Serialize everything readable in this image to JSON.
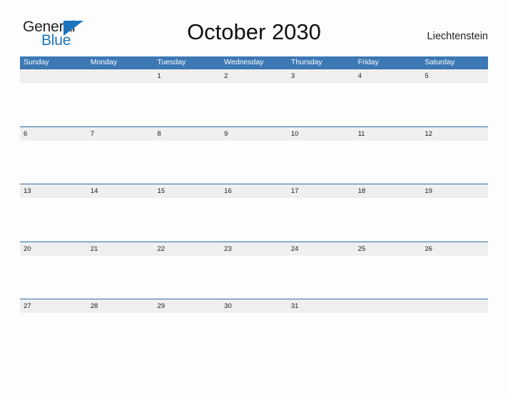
{
  "logo": {
    "word_one": "General",
    "word_two": "Blue",
    "triangle_icon": "triangle-icon",
    "colors": {
      "blue": "#1b75bb",
      "dark": "#231f20"
    }
  },
  "header": {
    "title": "October 2030",
    "country": "Liechtenstein"
  },
  "calendar": {
    "colors": {
      "header_blue": "#3c78b4",
      "divider_blue": "#2f6ca6",
      "band_gray": "#efefef",
      "page_background": "#fdfdfd"
    },
    "weekdays": [
      "Sunday",
      "Monday",
      "Tuesday",
      "Wednesday",
      "Thursday",
      "Friday",
      "Saturday"
    ],
    "weeks": [
      [
        "",
        "",
        "1",
        "2",
        "3",
        "4",
        "5"
      ],
      [
        "6",
        "7",
        "8",
        "9",
        "10",
        "11",
        "12"
      ],
      [
        "13",
        "14",
        "15",
        "16",
        "17",
        "18",
        "19"
      ],
      [
        "20",
        "21",
        "22",
        "23",
        "24",
        "25",
        "26"
      ],
      [
        "27",
        "28",
        "29",
        "30",
        "31",
        "",
        ""
      ]
    ]
  }
}
